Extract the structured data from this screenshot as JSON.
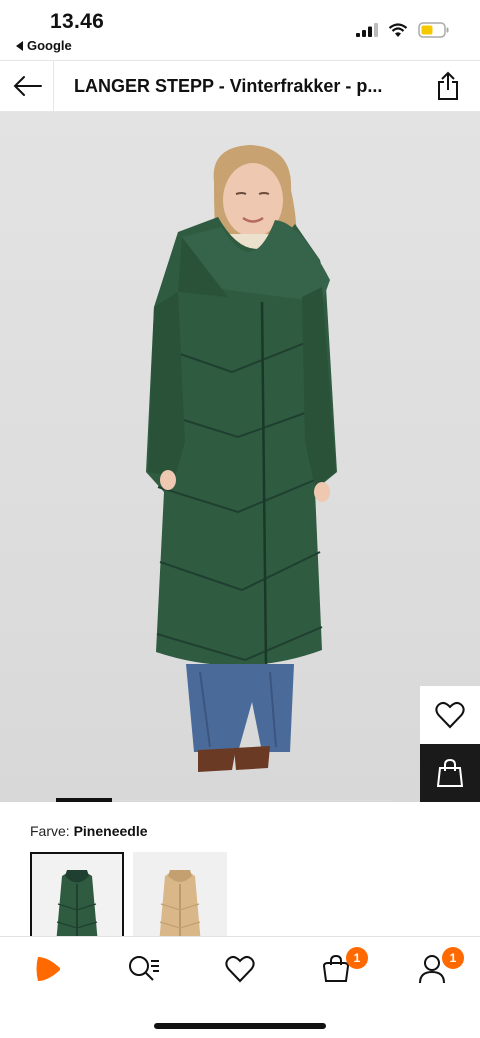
{
  "status_bar": {
    "time": "13.46",
    "back_app": "Google"
  },
  "header": {
    "title": "LANGER STEPP - Vinterfrakker - p..."
  },
  "product": {
    "image_alt": "Green quilted long puffer coat worn by model"
  },
  "color": {
    "label": "Farve:",
    "value": "Pineneedle",
    "swatches": [
      "green coat",
      "camel coat"
    ]
  },
  "nav": {
    "bag_count": "1",
    "account_count": "1"
  },
  "colors": {
    "accent": "#ff6900",
    "coat": "#2f5b41"
  }
}
